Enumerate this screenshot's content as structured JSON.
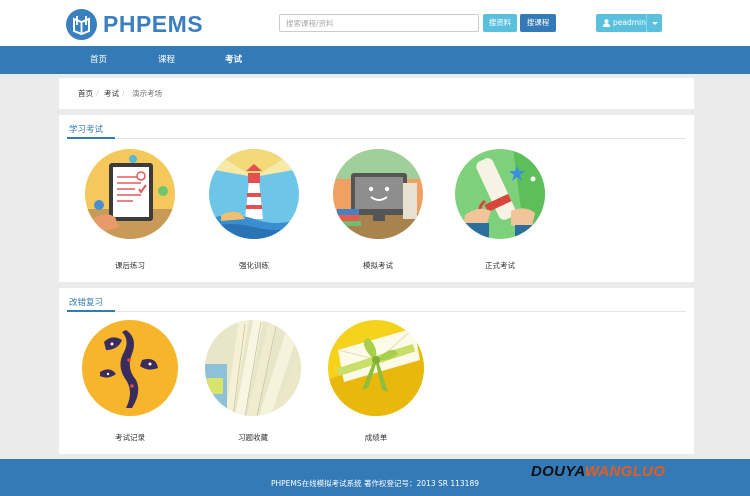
{
  "header": {
    "logo_text": "PHPEMS",
    "search_placeholder": "搜索课程/资料",
    "search_material_label": "搜资料",
    "search_course_label": "搜课程",
    "user_name": "peadmin"
  },
  "nav": {
    "items": [
      {
        "label": "首页"
      },
      {
        "label": "课程"
      },
      {
        "label": "考试"
      }
    ],
    "active": "考试"
  },
  "breadcrumb": {
    "items": [
      "首页",
      "考试",
      "演示考场"
    ],
    "separator": "/"
  },
  "sections": [
    {
      "title": "学习考试",
      "tiles": [
        {
          "label": "课后练习",
          "icon": "exam-paper-icon"
        },
        {
          "label": "强化训练",
          "icon": "lighthouse-icon"
        },
        {
          "label": "模拟考试",
          "icon": "computer-monitor-icon"
        },
        {
          "label": "正式考试",
          "icon": "diploma-scroll-icon"
        }
      ]
    },
    {
      "title": "改错复习",
      "tiles": [
        {
          "label": "考试记录",
          "icon": "abstract-figure-icon"
        },
        {
          "label": "习题收藏",
          "icon": "book-pages-icon"
        },
        {
          "label": "成绩单",
          "icon": "ribbon-envelope-icon"
        }
      ]
    }
  ],
  "footer": {
    "copyright": "PHPEMS在线模拟考试系统 著作权登记号：2013 SR 113189",
    "watermark_a": "DOUYA",
    "watermark_b": "WANGLUO"
  },
  "colors": {
    "primary": "#337ab7",
    "info": "#5bc0de",
    "background": "#ebebeb",
    "watermark_accent": "#e85c1a"
  }
}
